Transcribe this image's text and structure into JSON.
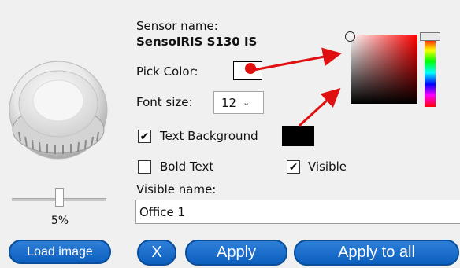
{
  "sensor": {
    "name_label": "Sensor name:",
    "name_value": "SensoIRIS S130 IS",
    "image_icon": "smoke-detector-icon"
  },
  "zoom": {
    "value_text": "5%",
    "fraction": 0.5
  },
  "pick_color": {
    "label": "Pick Color:",
    "color": "#ffffff"
  },
  "font_size": {
    "label": "Font size:",
    "value": "12",
    "chevron": "⌄"
  },
  "text_background": {
    "label": "Text Background",
    "checked": true,
    "color": "#000000"
  },
  "bold_text": {
    "label": "Bold Text",
    "checked": false
  },
  "visible": {
    "label": "Visible",
    "checked": true
  },
  "visible_name": {
    "label": "Visible name:",
    "value": "Office 1"
  },
  "buttons": {
    "load_image": "Load image",
    "close": "X",
    "apply": "Apply",
    "apply_to_all": "Apply to all"
  },
  "checkmark": "✔",
  "color_picker": {
    "hue_color": "#ff0000",
    "hue_spectrum": [
      "#ff0000",
      "#ffff00",
      "#00ff00",
      "#00ffff",
      "#0000ff",
      "#ff00ff",
      "#ff0000"
    ]
  },
  "annotation_color": "#e01010"
}
